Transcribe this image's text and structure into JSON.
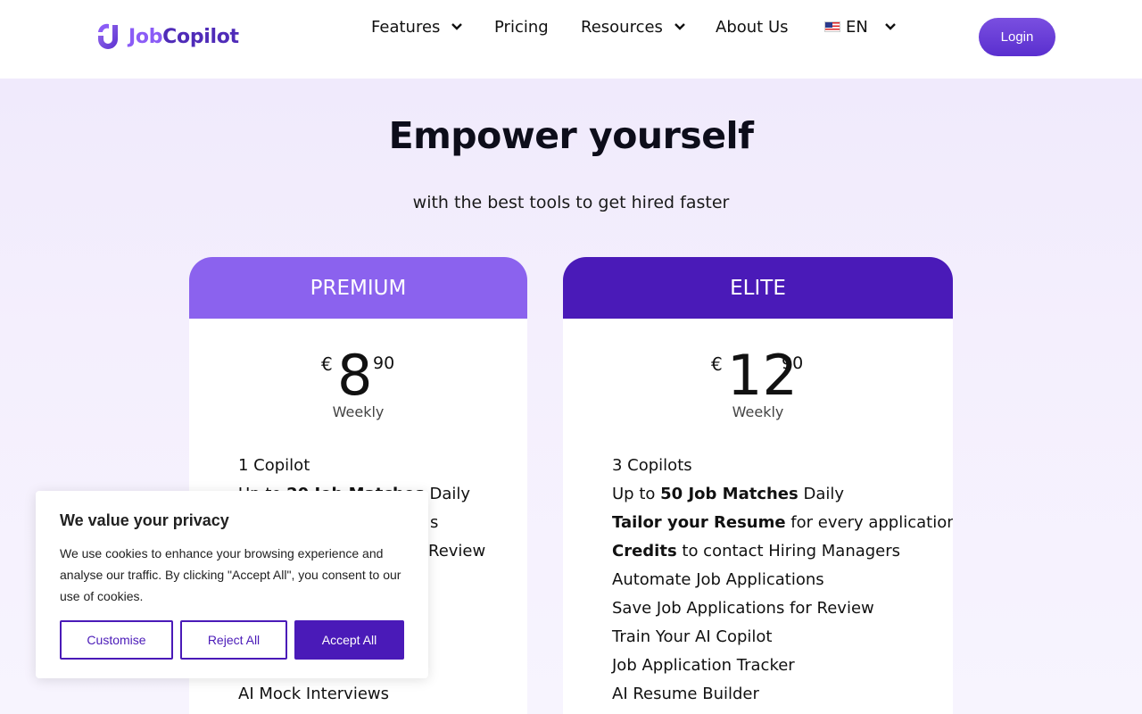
{
  "brand": {
    "name_part1": "Job",
    "name_part2": "Copilot",
    "primary_color": "#4a1ab8",
    "accent_color": "#8b62ee"
  },
  "nav": {
    "features": "Features",
    "pricing": "Pricing",
    "resources": "Resources",
    "about": "About Us",
    "language": "EN",
    "login": "Login"
  },
  "hero": {
    "title": "Empower yourself",
    "subtitle": "with the best tools to get hired faster"
  },
  "plans": [
    {
      "name": "PREMIUM",
      "currency": "€",
      "amount": "8",
      "cents": "90",
      "period": "Weekly",
      "features": [
        {
          "pre": "1 Copilot",
          "bold": "",
          "post": ""
        },
        {
          "pre": "Up to ",
          "bold": "20 Job Matches",
          "post": " Daily"
        },
        {
          "pre": "",
          "bold": "",
          "post": "s"
        },
        {
          "pre": "",
          "bold": "",
          "post": "Review"
        },
        {
          "pre": "AI Mock Interviews",
          "bold": "",
          "post": ""
        }
      ]
    },
    {
      "name": "ELITE",
      "currency": "€",
      "amount": "12",
      "cents": "90",
      "period": "Weekly",
      "features": [
        {
          "pre": "3 Copilots",
          "bold": "",
          "post": ""
        },
        {
          "pre": "Up to ",
          "bold": "50 Job Matches",
          "post": " Daily"
        },
        {
          "pre": "",
          "bold": "Tailor your Resume",
          "post": " for every application"
        },
        {
          "pre": "",
          "bold": "Credits",
          "post": " to contact Hiring Managers"
        },
        {
          "pre": "Automate Job Applications",
          "bold": "",
          "post": ""
        },
        {
          "pre": "Save Job Applications for Review",
          "bold": "",
          "post": ""
        },
        {
          "pre": "Train Your AI Copilot",
          "bold": "",
          "post": ""
        },
        {
          "pre": "Job Application Tracker",
          "bold": "",
          "post": ""
        },
        {
          "pre": "AI Resume Builder",
          "bold": "",
          "post": ""
        }
      ]
    }
  ],
  "cookie": {
    "title": "We value your privacy",
    "text": "We use cookies to enhance your browsing experience and analyse our traffic. By clicking \"Accept All\", you consent to our use of cookies.",
    "customise": "Customise",
    "reject": "Reject All",
    "accept": "Accept All"
  }
}
